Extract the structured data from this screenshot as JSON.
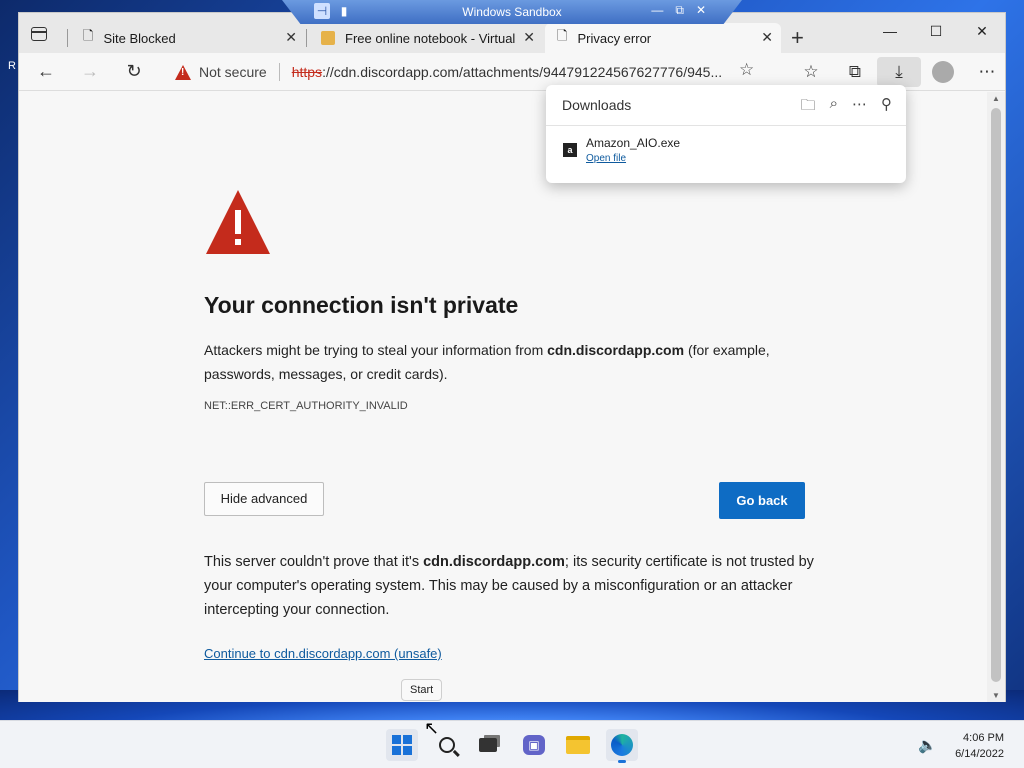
{
  "desktop": {
    "left_text": "R"
  },
  "sandbox": {
    "title": "Windows Sandbox"
  },
  "browser": {
    "tabs": [
      {
        "label": "Site Blocked",
        "icon": "document-icon"
      },
      {
        "label": "Free online notebook - Virtual N",
        "icon": "notebook-icon"
      },
      {
        "label": "Privacy error",
        "icon": "privacy-error-icon"
      }
    ],
    "address": {
      "security_label": "Not secure",
      "url_scheme": "https",
      "url_rest": "://cdn.discordapp.com/attachments/944791224567627776/945..."
    }
  },
  "error_page": {
    "title": "Your connection isn't private",
    "desc_prefix": "Attackers might be trying to steal your information from ",
    "desc_domain": "cdn.discordapp.com",
    "desc_suffix": " (for example, passwords, messages, or credit cards).",
    "error_code": "NET::ERR_CERT_AUTHORITY_INVALID",
    "hide_advanced_label": "Hide advanced",
    "go_back_label": "Go back",
    "advanced_prefix": "This server couldn't prove that it's ",
    "advanced_domain": "cdn.discordapp.com",
    "advanced_suffix": "; its security certificate is not trusted by your computer's operating system. This may be caused by a misconfiguration or an attacker intercepting your connection.",
    "continue_link": "Continue to cdn.discordapp.com (unsafe)",
    "accent_color": "#0e6cc4",
    "warning_color": "#c42b1c"
  },
  "downloads": {
    "title": "Downloads",
    "item": {
      "filename": "Amazon_AIO.exe",
      "action": "Open file",
      "icon_letter": "a"
    }
  },
  "taskbar": {
    "tooltip": "Start",
    "time": "4:06 PM",
    "date": "6/14/2022"
  }
}
